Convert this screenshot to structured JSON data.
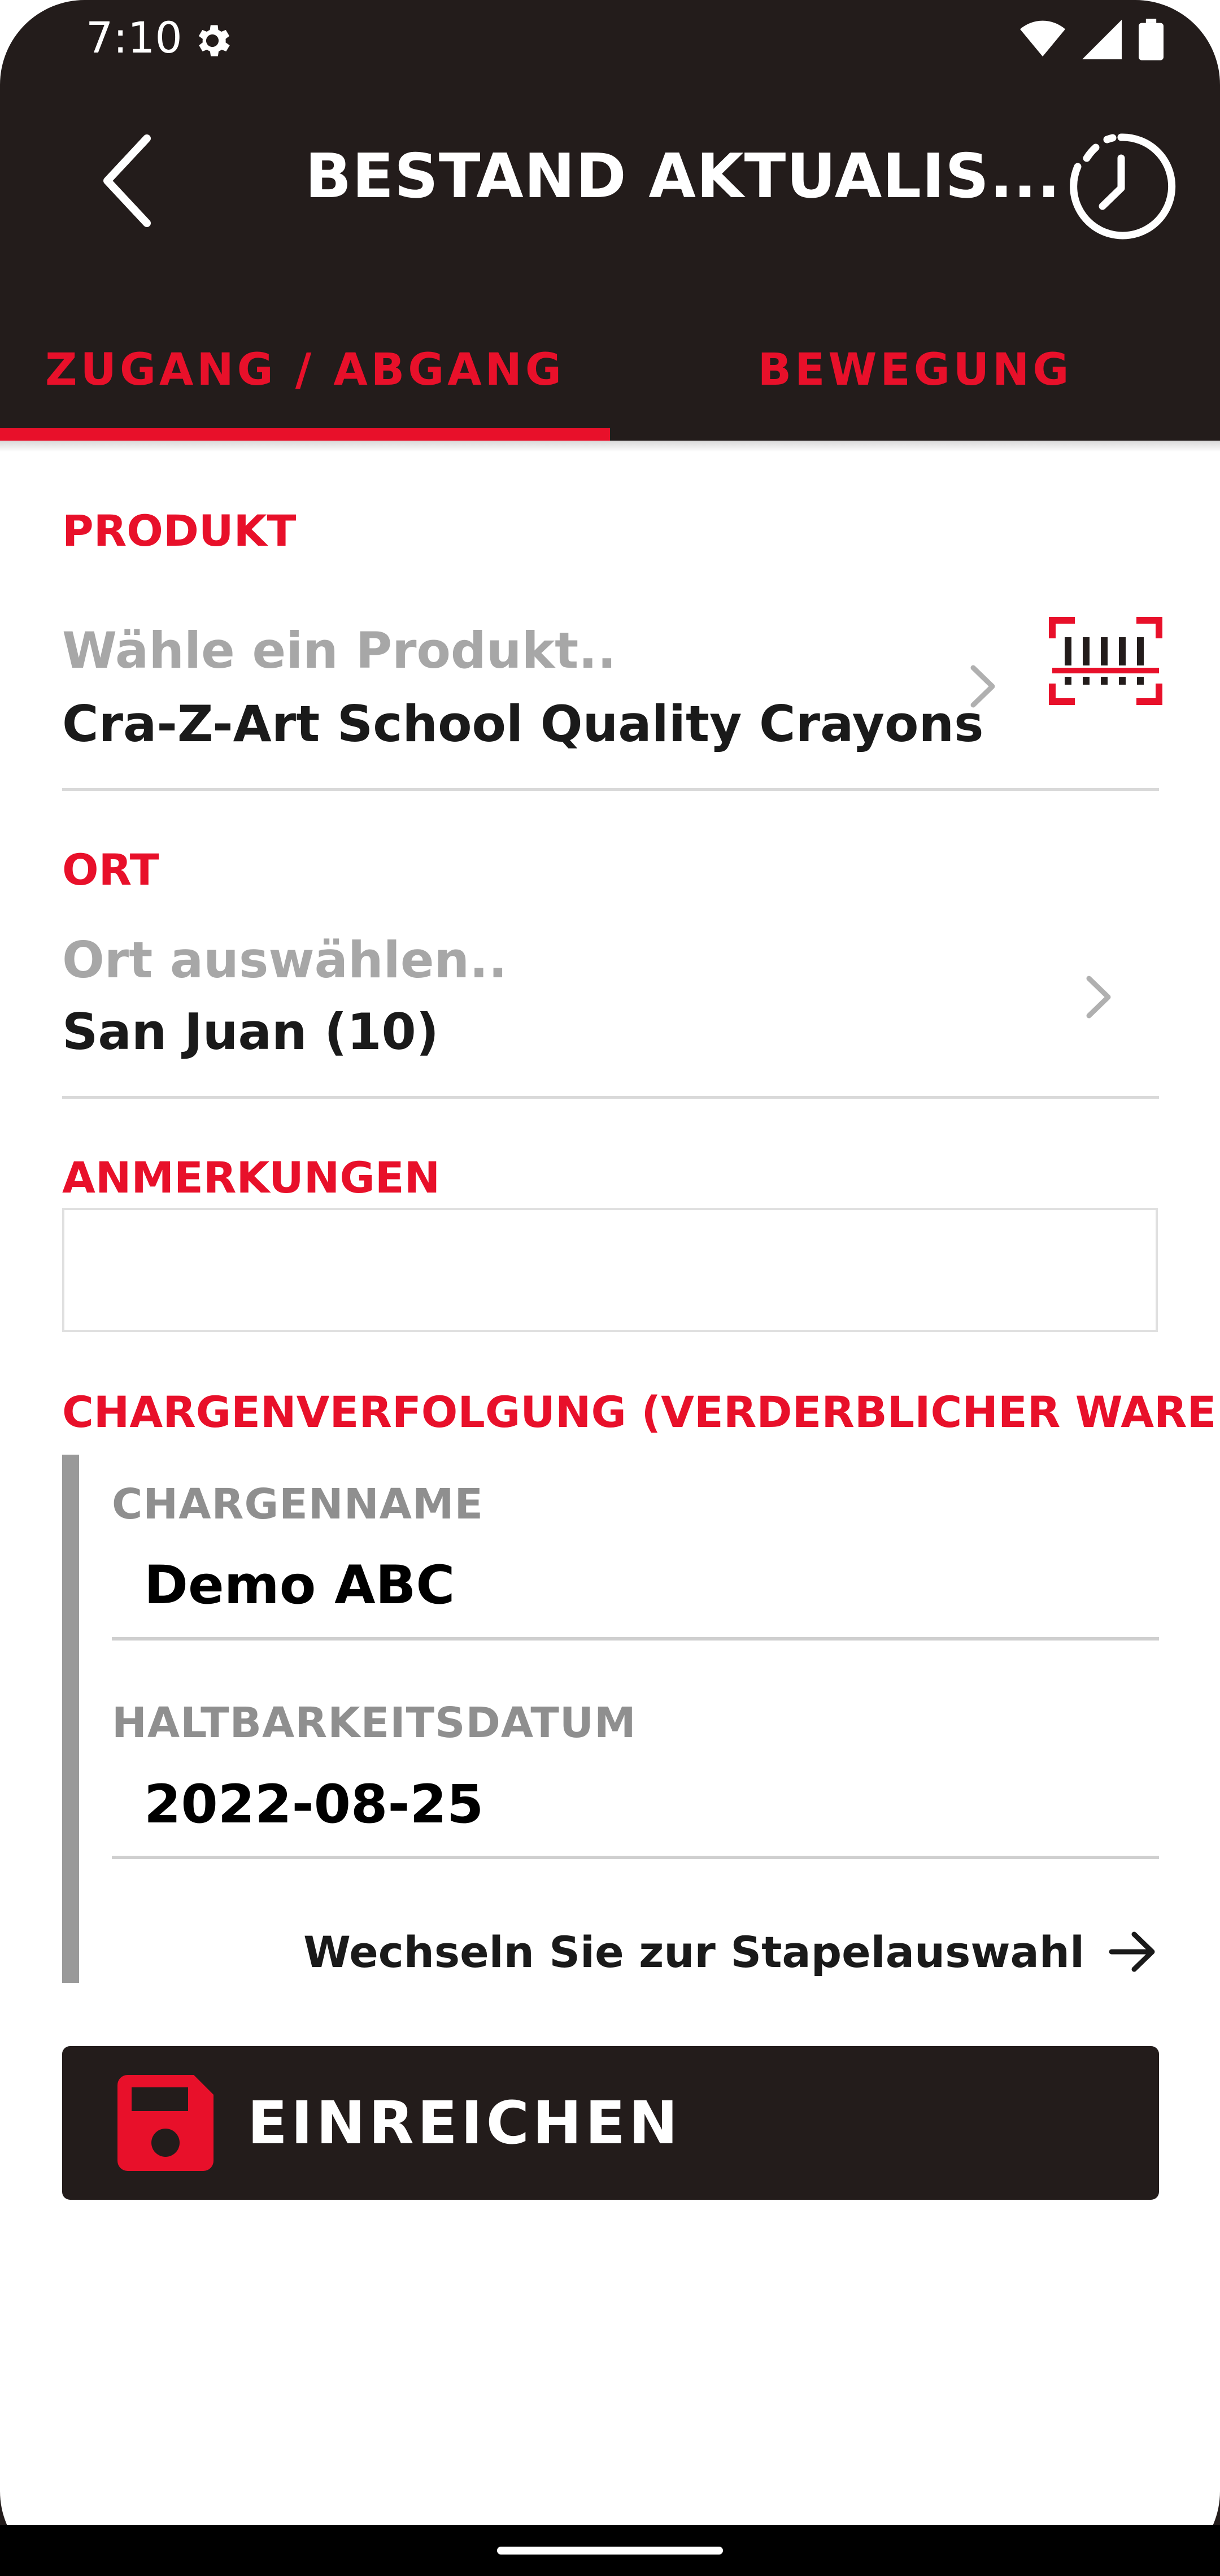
{
  "status_bar": {
    "time": "7:10"
  },
  "app_bar": {
    "title": "BESTAND AKTUALIS..."
  },
  "tabs": [
    {
      "label": "ZUGANG / ABGANG",
      "selected": true
    },
    {
      "label": "BEWEGUNG",
      "selected": false
    }
  ],
  "product": {
    "section_label": "PRODUKT",
    "placeholder": "Wähle ein Produkt..",
    "value": "Cra-Z-Art School Quality Crayons"
  },
  "location": {
    "section_label": "ORT",
    "placeholder": "Ort auswählen..",
    "value": "San Juan (10)"
  },
  "notes": {
    "section_label": "ANMERKUNGEN",
    "value": ""
  },
  "batch": {
    "section_label": "CHARGENVERFOLGUNG (VERDERBLICHER WAREN)",
    "name_label": "CHARGENNAME",
    "name_value": "Demo ABC",
    "expiry_label": "HALTBARKEITSDATUM",
    "expiry_value": "2022-08-25",
    "switch_label": "Wechseln Sie zur Stapelauswahl"
  },
  "submit": {
    "label": "EINREICHEN"
  },
  "colors": {
    "accent": "#e8102a",
    "dark": "#231c1b",
    "placeholder": "#a7a7a7"
  },
  "icons": {
    "back": "arrow-left-icon",
    "history": "clock-history-icon",
    "scan": "barcode-scan-icon",
    "chevron": "chevron-right-icon",
    "submit": "save-floppy-icon",
    "switch": "arrow-right-icon"
  }
}
